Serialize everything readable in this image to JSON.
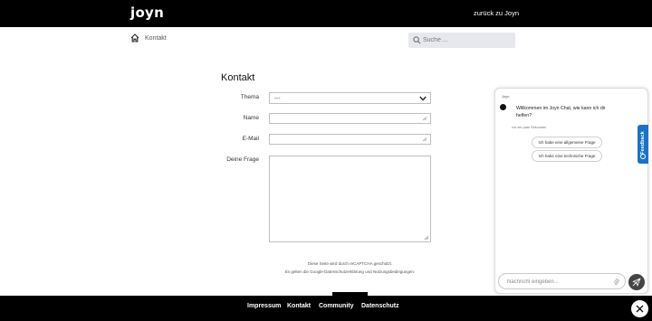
{
  "header": {
    "logo": "joyn",
    "back_link": "zurück zu Joyn"
  },
  "breadcrumb": {
    "home_icon": "home-icon",
    "current": "Kontakt"
  },
  "search": {
    "placeholder": "Suche ...",
    "icon": "search-icon"
  },
  "form": {
    "title": "Kontakt",
    "labels": {
      "thema": "Thema",
      "name": "Name",
      "email": "E-Mail",
      "question": "Deine Frage"
    },
    "thema_value": "---",
    "recaptcha_line1": "Diese Seite wird durch reCAPTCHA geschützt.",
    "recaptcha_line2": "Es gelten die Google-Datenschutzerklärung und Nutzungsbedingungen."
  },
  "footer": {
    "links": [
      "Impressum",
      "Kontakt",
      "Community",
      "Datenschutz"
    ]
  },
  "chat": {
    "sender": "Joyn",
    "message": "Willkommen im Joyn Chat, wie kann ich dir helfen?",
    "timestamp": "vor ein paar Sekunden",
    "options": [
      "Ich habe eine allgemeine Frage",
      "Ich habe eine technische Frage"
    ],
    "input_placeholder": "Nachricht eingeben..."
  },
  "feedback": {
    "label": "Feedback"
  },
  "colors": {
    "header_bg": "#000000",
    "footer_bg": "#000000",
    "feedback_blue": "#1a73c9",
    "search_bg": "#e6e8ee"
  }
}
